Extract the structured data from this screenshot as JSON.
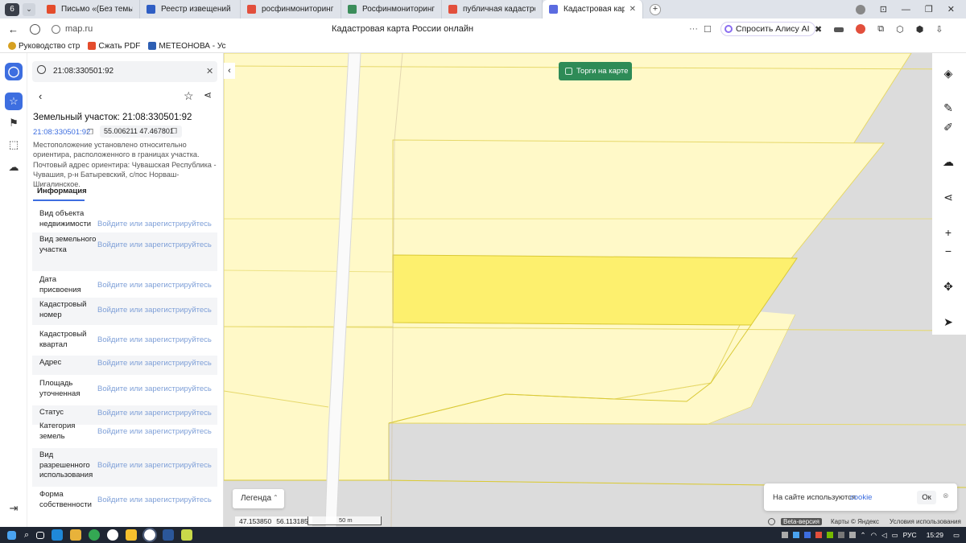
{
  "browser": {
    "tabs": [
      {
        "label": "Письмо «(Без темы)» — с",
        "color": "#e44c2c"
      },
      {
        "label": "Реестр извещений",
        "color": "#2f5ec4"
      },
      {
        "label": "росфинмониторинг личн",
        "color": "#e24f3c"
      },
      {
        "label": "Росфинмониторинг",
        "color": "#3b8d5a"
      },
      {
        "label": "публичная кадастровая к",
        "color": "#e24f3c"
      },
      {
        "label": "Кадастровая карта Ро",
        "color": "#5b6be0"
      }
    ],
    "tab_count_badge": "6",
    "url": "map.ru",
    "page_title": "Кадастровая карта России онлайн",
    "alice_button": "Спросить Алису AI",
    "bookmarks": [
      "Руководство стр",
      "Сжать PDF",
      "МЕТЕОНОВА - Ус"
    ]
  },
  "search": {
    "value": "21:08:330501:92"
  },
  "parcel": {
    "title": "Земельный участок: 21:08:330501:92",
    "number_link": "21:08:330501:92",
    "coords": "55.006211 47.467801",
    "description": "Местоположение установлено относительно ориентира, расположенного в границах участка. Почтовый адрес ориентира: Чувашская Республика - Чувашия, р-н Батыревский, с/пос Норваш-Шигалинское.",
    "tab_info": "Информация",
    "rows": [
      {
        "label": "Вид объекта недвижимости",
        "value": "Войдите или зарегистрируйтесь"
      },
      {
        "label": "Вид земельного участка",
        "value": "Войдите или зарегистрируйтесь"
      },
      {
        "label": "Дата присвоения",
        "value": "Войдите или зарегистрируйтесь"
      },
      {
        "label": "Кадастровый номер",
        "value": "Войдите или зарегистрируйтесь"
      },
      {
        "label": "Кадастровый квартал",
        "value": "Войдите или зарегистрируйтесь"
      },
      {
        "label": "Адрес",
        "value": "Войдите или зарегистрируйтесь"
      },
      {
        "label": "Площадь уточненная",
        "value": "Войдите или зарегистрируйтесь"
      },
      {
        "label": "Статус",
        "value": "Войдите или зарегистрируйтесь"
      },
      {
        "label": "Категория земель",
        "value": "Войдите или зарегистрируйтесь"
      },
      {
        "label": "Вид разрешенного использования",
        "value": "Войдите или зарегистрируйтесь"
      },
      {
        "label": "Форма собственности",
        "value": "Войдите или зарегистрируйтесь"
      }
    ]
  },
  "map": {
    "auction_toggle": "Торги на карте",
    "legend": "Легенда",
    "coord_readout_1": "47.153850",
    "coord_readout_2": "56.113185",
    "scale_label": "50 m",
    "cookie_text": "На сайте используются",
    "cookie_link": "cookie",
    "cookie_ok": "Ок",
    "beta": "Beta-версия",
    "attribution": "Карты © Яндекс",
    "terms": "Условия использования",
    "colors": {
      "parcel": "#fff9c8",
      "selected": "#fdf06e",
      "border": "#e6d86a",
      "green": "#2e8b57"
    }
  },
  "taskbar": {
    "lang": "РУС",
    "time": "15:29"
  }
}
